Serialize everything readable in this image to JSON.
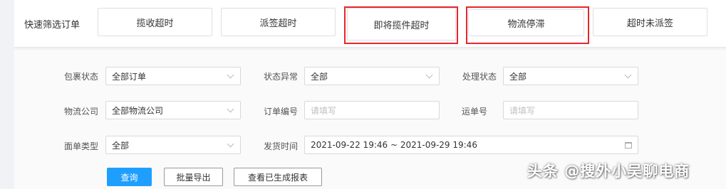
{
  "quick_filter": {
    "label": "快速筛选订单",
    "buttons": [
      "揽收超时",
      "派签超时",
      "即将揽件超时",
      "物流停滞",
      "超时未派签"
    ]
  },
  "filters": {
    "package_status": {
      "label": "包裹状态",
      "value": "全部订单"
    },
    "status_exception": {
      "label": "状态异常",
      "value": "全部"
    },
    "process_status": {
      "label": "处理状态",
      "value": "全部"
    },
    "logistics_company": {
      "label": "物流公司",
      "value": "全部物流公司"
    },
    "order_no": {
      "label": "订单编号",
      "placeholder": "请填写"
    },
    "waybill_no": {
      "label": "运单号",
      "placeholder": "请填写"
    },
    "form_type": {
      "label": "面单类型",
      "value": "全部"
    },
    "ship_time": {
      "label": "发货时间",
      "value": "2021-09-22 19:46 ~ 2021-09-29 19:46"
    }
  },
  "actions": {
    "query": "查询",
    "batch_export": "批量导出",
    "view_reports": "查看已生成报表"
  },
  "watermark": "头条 @搜外小吴聊电商",
  "colors": {
    "highlight": "#e8262b",
    "primary": "#1e9fff"
  }
}
